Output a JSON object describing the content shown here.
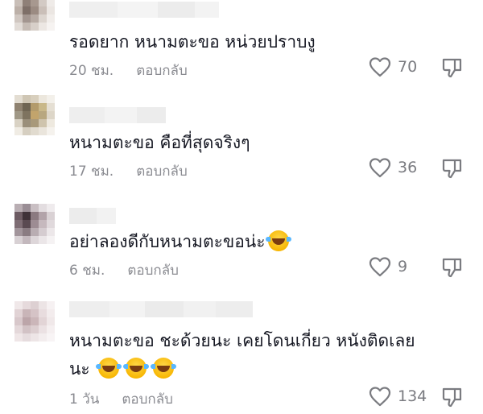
{
  "comments": [
    {
      "text": "รอดยาก หนามตะขอ หน่วยปราบงู",
      "emoji_count": 0,
      "time": "20 ชม.",
      "reply_label": "ตอบกลับ",
      "likes": "70",
      "avatar_colors": [
        "#d9d2cc",
        "#b8aea6",
        "#9d918a",
        "#e6e1dc",
        "#f2eeeb",
        "#c9bfb8",
        "#8f8078",
        "#a7988f",
        "#d3cac4",
        "#efebe8",
        "#bcb0a8",
        "#7e6f68",
        "#9b8b82",
        "#cabfb8",
        "#ebe6e2",
        "#d0c7c1",
        "#a39690",
        "#b7aba4",
        "#dcd5cf",
        "#f1edea",
        "#e2dcd7",
        "#c6bcb5",
        "#d7cfc9",
        "#ece7e3",
        "#f6f3f1"
      ]
    },
    {
      "text": "หนามตะขอ คือที่สุดจริงๆ",
      "emoji_count": 0,
      "time": "17 ชม.",
      "reply_label": "ตอบกลับ",
      "likes": "36",
      "avatar_colors": [
        "#e3ddd2",
        "#cfc6b4",
        "#d8cfbd",
        "#ece7dd",
        "#f3f0ea",
        "#8f8270",
        "#6f6553",
        "#b39b6b",
        "#c9b889",
        "#e5dfd3",
        "#a09886",
        "#7e735f",
        "#c2a46c",
        "#b8a77f",
        "#ddd6c8",
        "#d9d2c4",
        "#9a8f7b",
        "#a8997a",
        "#cfc4ad",
        "#eee9df",
        "#f0ece4",
        "#d6cfc1",
        "#e1dbcf",
        "#eae5dc",
        "#f5f2ed"
      ]
    },
    {
      "text": "อย่าลองดีกับหนามตะขอน่ะ",
      "emoji_count": 1,
      "time": "6 ชม.",
      "reply_label": "ตอบกลับ",
      "likes": "9",
      "avatar_colors": [
        "#b9aeb3",
        "#9a8e95",
        "#c9bfc3",
        "#e3dde0",
        "#efebed",
        "#6d5c63",
        "#3f3238",
        "#8b7a80",
        "#b2a3a9",
        "#d9d1d4",
        "#7e6d74",
        "#5a4a51",
        "#9d8c93",
        "#c6b9be",
        "#e0d9dc",
        "#a2959b",
        "#8a7c82",
        "#b9adb2",
        "#d5ccd0",
        "#ece7e9",
        "#d8d1d4",
        "#c3b8bd",
        "#ddd6d9",
        "#ebe6e8",
        "#f5f2f3"
      ]
    },
    {
      "text": "หนามตะขอ ชะด้วยนะ เคยโดนเกี่ยว หนังติดเลย",
      "text_line2": "นะ",
      "emoji_count": 3,
      "time": "1 วัน",
      "reply_label": "ตอบกลับ",
      "likes": "134",
      "avatar_colors": [
        "#f0e8e9",
        "#e6dadc",
        "#ddd0d2",
        "#ece4e5",
        "#f6f1f2",
        "#e1d3d5",
        "#c9b5b8",
        "#d5c3c6",
        "#e8dcde",
        "#f3eced",
        "#d8c8cb",
        "#bca5a9",
        "#cbb6b9",
        "#e2d4d6",
        "#f0e8e9",
        "#e4d8da",
        "#d2c2c5",
        "#dcced0",
        "#ebe1e3",
        "#f5eff0",
        "#efe6e7",
        "#e6dcde",
        "#ede5e6",
        "#f3edee",
        "#f8f4f5"
      ]
    }
  ],
  "icons": {
    "like": "heart-outline-icon",
    "dislike": "thumbs-down-icon"
  },
  "colors": {
    "text": "#161823",
    "meta": "#8a8b91",
    "icon": "#7a7b80"
  }
}
